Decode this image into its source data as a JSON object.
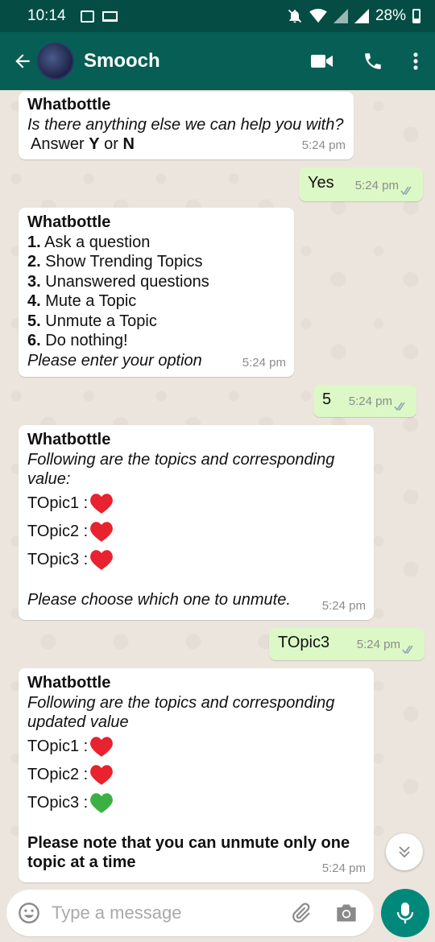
{
  "status_bar": {
    "time": "10:14",
    "battery": "28%"
  },
  "header": {
    "back_icon": "arrow-left-icon",
    "contact_name": "Smooch",
    "icons": [
      "videocam-icon",
      "phone-icon",
      "more-vert-icon"
    ]
  },
  "messages": [
    {
      "direction": "incoming",
      "sender": "Whatbottle",
      "question": "Is there anything else we can help you with?",
      "answer_prefix": "Answer ",
      "answer_y": "Y",
      "answer_or": " or ",
      "answer_n": "N",
      "time": "5:24 pm"
    },
    {
      "direction": "outgoing",
      "text": "Yes",
      "time": "5:24 pm",
      "status": "read"
    },
    {
      "direction": "incoming",
      "sender": "Whatbottle",
      "options": [
        {
          "num": "1.",
          "label": " Ask a question"
        },
        {
          "num": "2.",
          "label": " Show Trending Topics"
        },
        {
          "num": "3.",
          "label": " Unanswered questions"
        },
        {
          "num": "4.",
          "label": " Mute a Topic"
        },
        {
          "num": "5.",
          "label": " Unmute a Topic"
        },
        {
          "num": "6.",
          "label": " Do nothing!"
        }
      ],
      "prompt": "Please enter your option",
      "time": "5:24 pm"
    },
    {
      "direction": "outgoing",
      "text": "5",
      "time": "5:24 pm",
      "status": "read"
    },
    {
      "direction": "incoming",
      "sender": "Whatbottle",
      "intro": "Following are the topics and corresponding value:",
      "topics": [
        {
          "label": "TOpic1 :",
          "heart": "red"
        },
        {
          "label": "TOpic2 :",
          "heart": "red"
        },
        {
          "label": "TOpic3 :",
          "heart": "red"
        }
      ],
      "prompt": "Please choose which one to unmute.",
      "time": "5:24 pm"
    },
    {
      "direction": "outgoing",
      "text": "TOpic3",
      "time": "5:24 pm",
      "status": "read"
    },
    {
      "direction": "incoming",
      "sender": "Whatbottle",
      "intro": "Following are the topics and corresponding updated value",
      "topics": [
        {
          "label": "TOpic1 :",
          "heart": "red"
        },
        {
          "label": "TOpic2 :",
          "heart": "red"
        },
        {
          "label": "TOpic3 :",
          "heart": "green"
        }
      ],
      "note": "Please note that you can unmute only one topic at a time",
      "time": "5:24 pm"
    }
  ],
  "input": {
    "placeholder": "Type a message"
  },
  "colors": {
    "header": "#075e54",
    "status_bar": "#054d44",
    "outgoing_bubble": "#dcf8c6",
    "incoming_bubble": "#ffffff",
    "read_ticks": "#8fa8b8",
    "heart_red": "#e8222e",
    "heart_green": "#3cb043",
    "fab": "#00897b"
  }
}
